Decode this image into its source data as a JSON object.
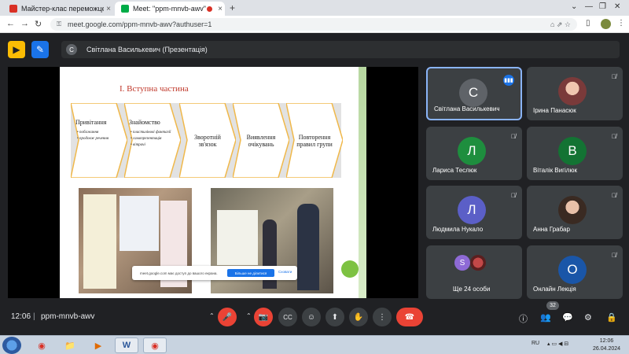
{
  "browser": {
    "tabs": [
      {
        "title": "Майстер-клас переможце облас",
        "close": "×",
        "favicon_color": "#d93025"
      },
      {
        "title": "Meet: \"ppm-mnvb-awv\"",
        "close": "×",
        "favicon_color": "#00ac47"
      }
    ],
    "new_tab": "+",
    "window_controls": [
      "⌄",
      "—",
      "❐",
      "✕"
    ],
    "url": "meet.google.com/ppm-mnvb-awv?authuser=1",
    "nav": {
      "back": "←",
      "forward": "→",
      "reload": "↻"
    },
    "omni_icons": "⌂ ⇗ ☆",
    "ext_icons": [
      "▯",
      "⋮"
    ]
  },
  "meet_header": {
    "app_icon_1": "▶",
    "app_icon_2": "✎",
    "presenter_initial": "С",
    "presenting_label": "Світлана Василькевич (Презентація)"
  },
  "slide": {
    "title": "I. Вступна частина",
    "chevrons": [
      {
        "heading": "Привітання",
        "items": [
          "побажання",
          "продовж речення"
        ]
      },
      {
        "heading": "Знайомство",
        "items": [
          "пластилінові фантазії",
          "самопрезентація",
          "вітрачі"
        ]
      },
      {
        "text": "Зворотній зв'язок"
      },
      {
        "text": "Виявлення очікувань"
      },
      {
        "text": "Повторення правил групи"
      }
    ],
    "sharing_notice": {
      "text": "meet.google.com має доступ до вашого екрана.",
      "primary": "Більше не ділитися",
      "secondary": "Сховати"
    }
  },
  "participants": [
    {
      "name": "Світлана Василькевич",
      "initial": "С",
      "color": "#5f6368",
      "speaking": true
    },
    {
      "name": "Ірина Панасюк",
      "initial": "",
      "color": "",
      "photo": true
    },
    {
      "name": "Лариса Теслюк",
      "initial": "Л",
      "color": "#1e8e3e"
    },
    {
      "name": "Віталік Вигілюк",
      "initial": "В",
      "color": "#137333"
    },
    {
      "name": "Людмила Нукало",
      "initial": "Л",
      "color": "#5b5fc7"
    },
    {
      "name": "Анна Грабар",
      "initial": "",
      "color": "",
      "photo": true
    },
    {
      "name": "Ще 24 особи",
      "initial": "S",
      "color": "#8e6ad6"
    },
    {
      "name": "Онлайн Лекція",
      "initial": "О",
      "color": "#1a56a8"
    }
  ],
  "icons": {
    "mic_off": "🎙̸",
    "voice": "▮▮▮"
  },
  "controls": {
    "time": "12:06",
    "separator": "|",
    "meeting_code": "ppm-mnvb-awv",
    "chevron": "⌃",
    "mic": "🎤",
    "camera": "📷",
    "captions": "CC",
    "emoji": "☺",
    "present": "⬆",
    "hand": "✋",
    "more": "⋮",
    "end": "☎",
    "info": "ⓘ",
    "people": "👥",
    "chat": "💬",
    "activities": "⚙",
    "host": "🔒",
    "people_count": "32"
  },
  "taskbar": {
    "apps": [
      "⊞",
      "◉",
      "📁",
      "▶",
      "W",
      "◉"
    ],
    "lang": "RU",
    "tray_icons": "▴ ▭ ◀ ⊟",
    "time": "12:06",
    "date": "26.04.2024"
  }
}
